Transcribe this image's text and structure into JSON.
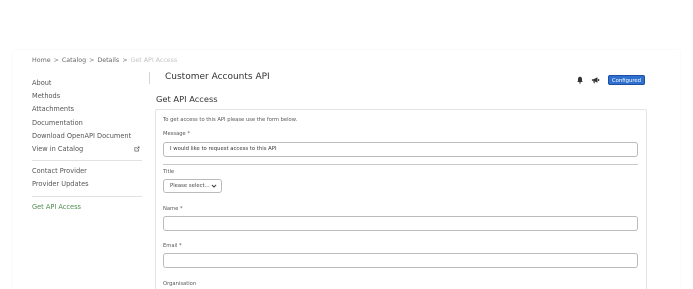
{
  "breadcrumb": {
    "items": [
      "Home",
      "Catalog",
      "Details"
    ],
    "separator": ">",
    "current": "Get API Access"
  },
  "sidebar": {
    "items": [
      {
        "label": "About"
      },
      {
        "label": "Methods"
      },
      {
        "label": "Attachments"
      },
      {
        "label": "Documentation"
      },
      {
        "label": "Download OpenAPI Document"
      },
      {
        "label": "View in Catalog",
        "icon": "external-link-icon"
      }
    ],
    "contact_items": [
      {
        "label": "Contact Provider"
      },
      {
        "label": "Provider Updates"
      }
    ],
    "active_item": "Get API Access"
  },
  "header": {
    "api_title": "Customer Accounts API",
    "badge": "Configured",
    "icons": [
      "bell-icon",
      "megaphone-icon"
    ]
  },
  "form": {
    "section_title": "Get API Access",
    "intro": "To get access to this API please use the form below.",
    "message_label": "Message *",
    "message_value": "I would like to request access to this API",
    "title_label": "Title",
    "title_value": "Please select...",
    "name_label": "Name *",
    "name_value": "",
    "email_label": "Email *",
    "email_value": "",
    "organisation_label": "Organisation"
  },
  "colors": {
    "active_link": "#4e8a4e",
    "badge_bg": "#2f6fd0"
  }
}
